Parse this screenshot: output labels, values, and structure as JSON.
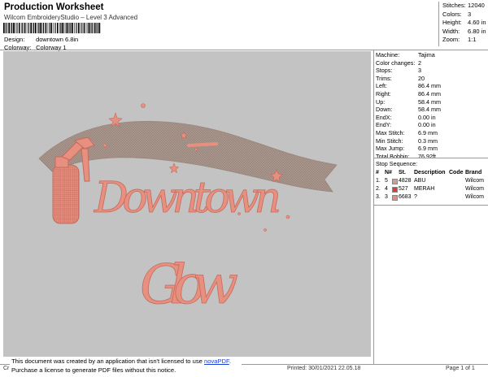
{
  "header": {
    "title": "Production Worksheet",
    "subtitle": "Wilcom EmbroideryStudio – Level 3 Advanced",
    "design_label": "Design:",
    "design_value": "downtown 6.8in",
    "colorway_label": "Colorway:",
    "colorway_value": "Colorway 1"
  },
  "stats": [
    {
      "label": "Stitches:",
      "value": "12040"
    },
    {
      "label": "Colors:",
      "value": "3"
    },
    {
      "label": "Height:",
      "value": "4.60 in"
    },
    {
      "label": "Width:",
      "value": "6.80 in"
    },
    {
      "label": "Zoom:",
      "value": "1:1"
    }
  ],
  "design_text": {
    "line1": "Downtown",
    "line2": "Glow"
  },
  "machine_info": [
    {
      "label": "Machine:",
      "value": "Tajima"
    },
    {
      "label": "Color changes:",
      "value": "2"
    },
    {
      "label": "Stops:",
      "value": "3"
    },
    {
      "label": "Trims:",
      "value": "20"
    },
    {
      "label": "Left:",
      "value": "86.4 mm"
    },
    {
      "label": "Right:",
      "value": "86.4 mm"
    },
    {
      "label": "Up:",
      "value": "58.4 mm"
    },
    {
      "label": "Down:",
      "value": "58.4 mm"
    },
    {
      "label": "EndX:",
      "value": "0.00 in"
    },
    {
      "label": "EndY:",
      "value": "0.00 in"
    },
    {
      "label": "Max Stitch:",
      "value": "6.9 mm"
    },
    {
      "label": "Min Stitch:",
      "value": "0.3 mm"
    },
    {
      "label": "Max Jump:",
      "value": "6.9 mm"
    },
    {
      "label": "Total Bobbin:",
      "value": "76.92ft"
    }
  ],
  "stop_sequence": {
    "title": "Stop Sequence:",
    "headers": {
      "num": "#",
      "n": "N#",
      "st": "St.",
      "desc": "Description",
      "code": "Code",
      "brand": "Brand"
    },
    "rows": [
      {
        "num": "1.",
        "n": "5",
        "color": "#d89a93",
        "st": "4828",
        "desc": "ABU",
        "code": "",
        "brand": "Wilcom"
      },
      {
        "num": "2.",
        "n": "4",
        "color": "#e03a3a",
        "st": "527",
        "desc": "MERAH",
        "code": "",
        "brand": "Wilcom"
      },
      {
        "num": "3.",
        "n": "3",
        "color": "#ec8a80",
        "st": "6683",
        "desc": "?",
        "code": "",
        "brand": "Wilcom"
      }
    ]
  },
  "footer": {
    "left": "Cr",
    "notice_line1": "This document was created by an application that isn't licensed to use ",
    "notice_link": "novaPDF",
    "notice_line1_end": ".",
    "notice_line2": "Purchase a license to generate PDF files without this notice.",
    "printed": "Printed: 30/01/2021 22.05.18",
    "page": "Page 1 of 1"
  },
  "colors": {
    "canvas_bg": "#c3c3c3",
    "banner": "#a8968c",
    "thread_pink": "#e8907f",
    "thread_pink_dark": "#c46a5e"
  }
}
